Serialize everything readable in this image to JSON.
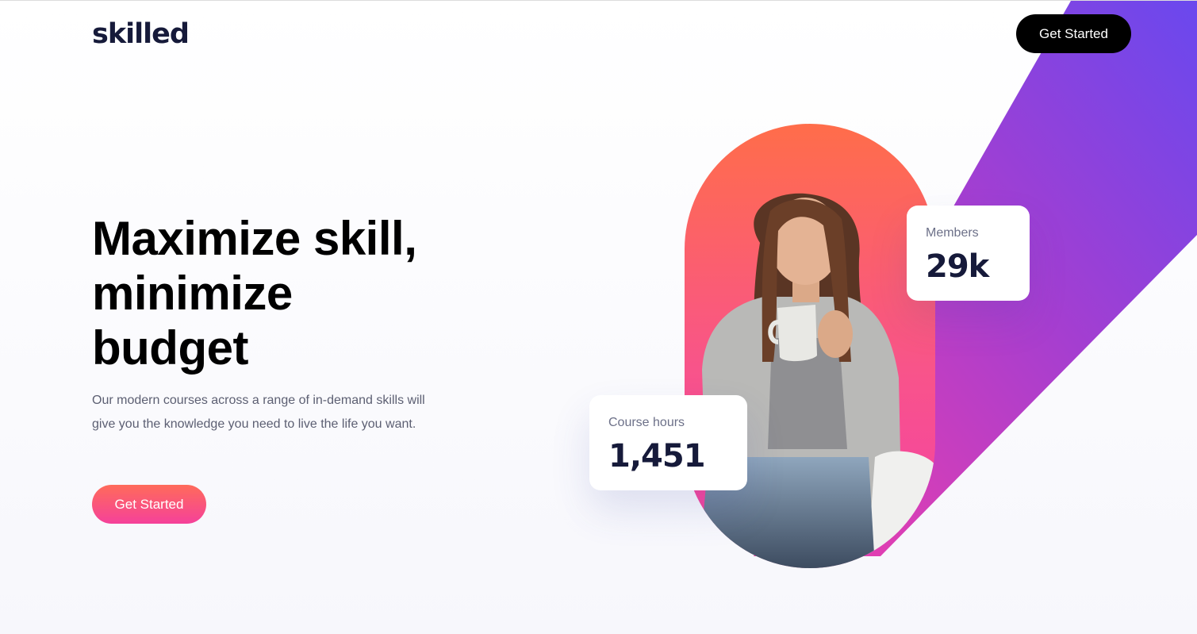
{
  "header": {
    "logo": "skilled",
    "cta_label": "Get Started"
  },
  "hero": {
    "headline": "Maximize skill, minimize budget",
    "description": "Our modern courses across a range of in-demand skills will give you the knowledge you need to live the life you want.",
    "cta_label": "Get Started"
  },
  "stats": {
    "members": {
      "label": "Members",
      "value": "29k"
    },
    "course_hours": {
      "label": "Course hours",
      "value": "1,451"
    }
  },
  "colors": {
    "brand_dark": "#161a3a",
    "diagonal_start": "#f43fa8",
    "diagonal_end": "#6a48ee",
    "pill_top": "#ff6d4a",
    "pill_bottom": "#f43fa8"
  }
}
